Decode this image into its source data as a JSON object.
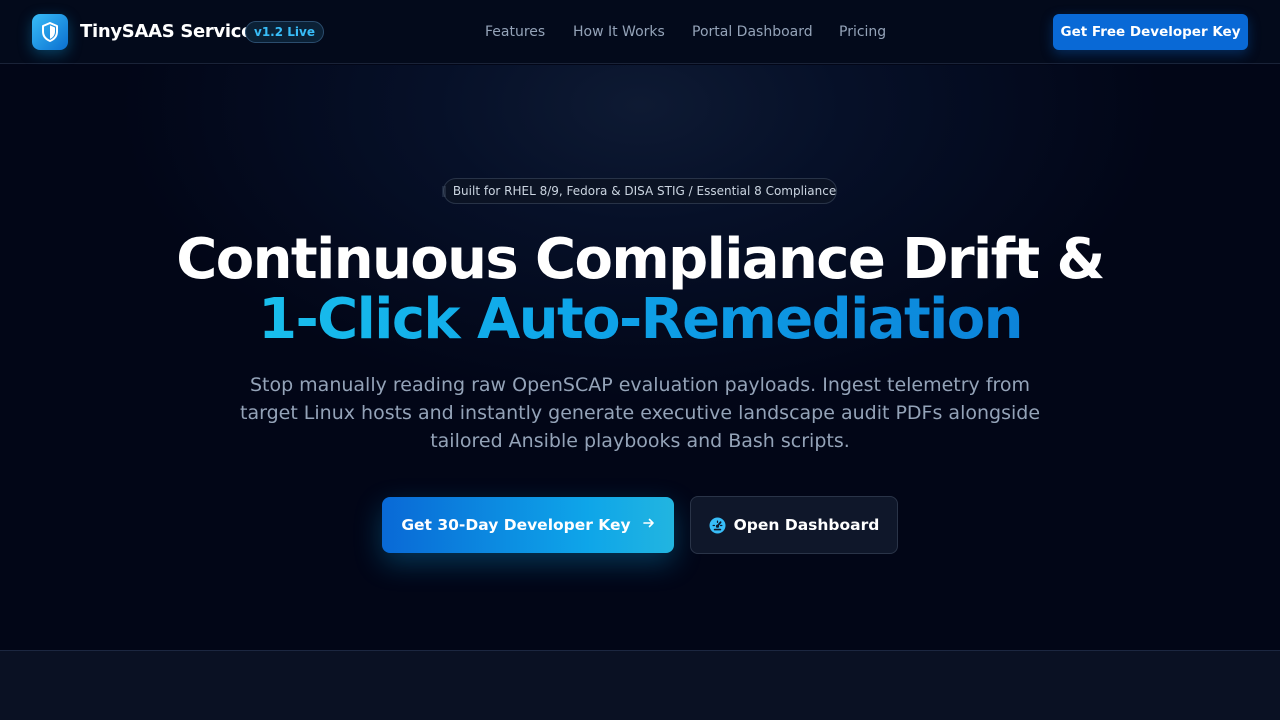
{
  "header": {
    "brand": "TinySAAS Services",
    "version_badge": "v1.2 Live",
    "logo_icon": "shield-icon",
    "nav": [
      {
        "label": "Features"
      },
      {
        "label": "How It Works"
      },
      {
        "label": "Portal Dashboard"
      },
      {
        "label": "Pricing"
      }
    ],
    "cta_label": "Get Free Developer Key"
  },
  "hero": {
    "eyebrow": "Built for RHEL 8/9, Fedora & DISA STIG / Essential 8 Compliance",
    "title_line1": "Continuous Compliance Drift &",
    "title_line2": "1-Click Auto-Remediation",
    "subtitle": "Stop manually reading raw OpenSCAP evaluation payloads. Ingest telemetry from target Linux hosts and instantly generate executive landscape audit PDFs alongside tailored Ansible playbooks and Bash scripts.",
    "primary_cta": "Get 30-Day Developer Key",
    "primary_cta_icon": "arrow-right-icon",
    "secondary_cta": "Open Dashboard",
    "secondary_cta_icon": "gauge-icon"
  },
  "colors": {
    "background": "#020617",
    "accent": "#0ea5e9",
    "accent_dark": "#0969d6",
    "cyan": "#22d3ee",
    "muted_text": "#94a3b8"
  }
}
